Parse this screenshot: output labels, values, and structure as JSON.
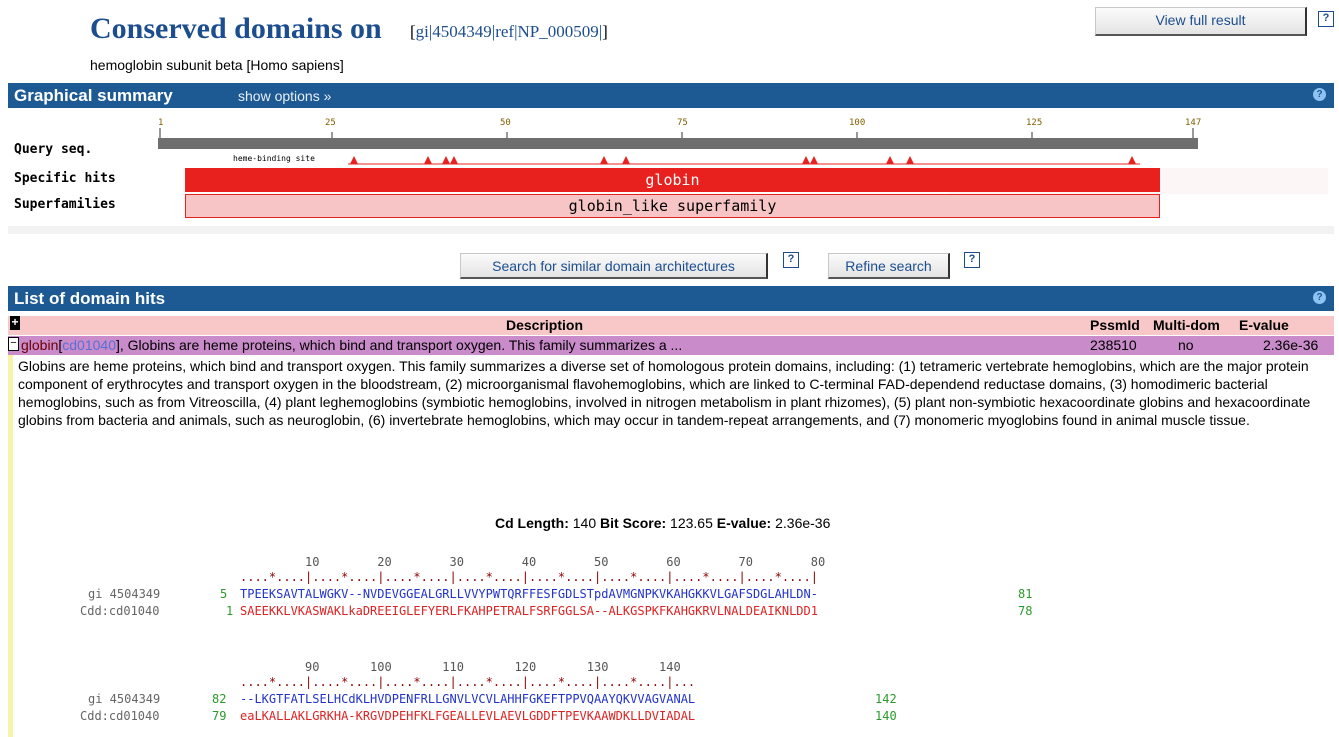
{
  "header": {
    "title": "Conserved domains on",
    "acc_open": "[",
    "acc_gi": "gi|4504349|ref|NP_000509|",
    "acc_close": "]",
    "subtitle": "hemoglobin subunit beta [Homo sapiens]",
    "view_full_result": "View full result",
    "help_glyph": "?"
  },
  "graphical": {
    "heading": "Graphical summary",
    "show_options": "show options »",
    "query_label": "Query seq.",
    "specific_label": "Specific hits",
    "superfam_label": "Superfamilies",
    "site_label": "heme-binding site",
    "ticks": [
      "1",
      "25",
      "50",
      "75",
      "100",
      "125",
      "147"
    ],
    "specific_hit": "globin",
    "superfamily_hit": "globin_like superfamily",
    "search_similar": "Search for similar domain architectures",
    "refine_search": "Refine search"
  },
  "hits": {
    "heading": "List of domain hits",
    "columns": {
      "description": "Description",
      "pssmid": "PssmId",
      "multidom": "Multi-dom",
      "evalue": "E-value"
    },
    "row": {
      "toggle": "−",
      "name": "globin",
      "id_open": "[",
      "cd": "cd01040",
      "id_close": "]",
      "desc": ", Globins are heme proteins, which bind and transport oxygen. This family summarizes a ...",
      "pssmid": "238510",
      "multidom": "no",
      "evalue": "2.36e-36"
    },
    "full_description": "Globins are heme proteins, which bind and transport oxygen. This family summarizes a diverse set of homologous protein domains, including: (1) tetrameric vertebrate hemoglobins, which are the major protein component of erythrocytes and transport oxygen in the bloodstream, (2) microorganismal flavohemoglobins, which are linked to C-terminal FAD-dependend reductase domains, (3) homodimeric bacterial hemoglobins, such as from Vitreoscilla, (4) plant leghemoglobins (symbiotic hemoglobins, involved in nitrogen metabolism in plant rhizomes), (5) plant non-symbiotic hexacoordinate globins and hexacoordinate globins from bacteria and animals, such as neuroglobin, (6) invertebrate hemoglobins, which may occur in tandem-repeat arrangements, and (7) monomeric myoglobins found in animal muscle tissue."
  },
  "alignment": {
    "cd_length_label": "Cd Length:",
    "cd_length": "140",
    "bit_score_label": "Bit Score:",
    "bit_score": "123.65",
    "evalue_label": "E-value:",
    "evalue": "2.36e-36",
    "block1": {
      "ruler_nums": "         10        20        30        40        50        60        70        80",
      "ruler": "....*....|....*....|....*....|....*....|....*....|....*....|....*....|....*....|",
      "q_name": "gi 4504349",
      "q_start": "5",
      "q_seq": "TPEEKSAVTALWGKV--NVDEVGGEALGRLLVVYPWTQRFFESFGDLSTpdAVMGNPKVKAHGKKVLGAFSDGLAHLDN-",
      "q_end": "81",
      "s_name": "Cdd:cd01040",
      "s_start": "1",
      "s_seq": "SAEEKKLVKASWAKLkaDREEIGLEFYERLFKAHPETRALFSRFGGLSA--ALKGSPKFKAHGKRVLNALDEAIKNLDD1",
      "s_end": "78"
    },
    "block2": {
      "ruler_nums": "         90       100       110       120       130       140",
      "ruler": "....*....|....*....|....*....|....*....|....*....|....*....|...",
      "q_name": "gi 4504349",
      "q_start": "82",
      "q_seq": "--LKGTFATLSELHCdKLHVDPENFRLLGNVLVCVLAHHFGKEFTPPVQAAYQKVVAGVANAL",
      "q_end": "142",
      "s_name": "Cdd:cd01040",
      "s_start": "79",
      "s_seq": "eaLKALLAKLGRKHA-KRGVDPEHFKLFGEALLEVLAEVLGDDFTPEVKAAWDKLLDVIADAL",
      "s_end": "140"
    }
  },
  "colors": {
    "nav_bar": "#1d5a94",
    "title": "#1c4e8f",
    "specific_hit": "#e8211f",
    "superfamily": "#f7c5c5",
    "hit_row": "#c98bc9",
    "header_row": "#f8c7c7"
  }
}
